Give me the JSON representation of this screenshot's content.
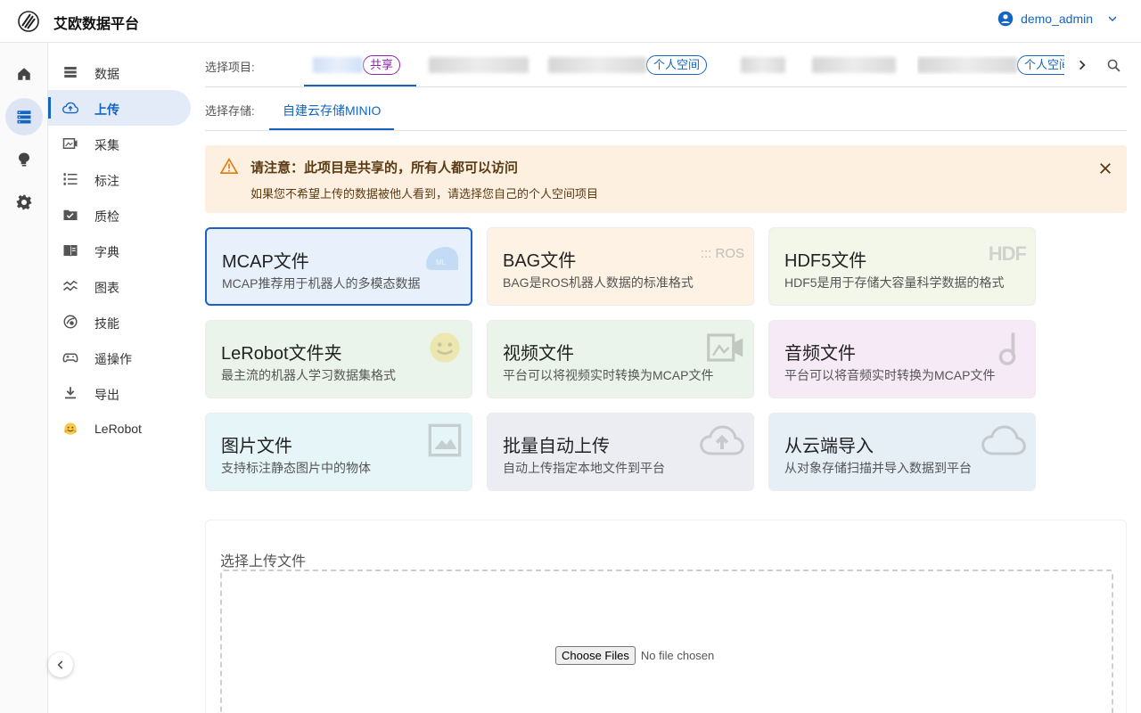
{
  "header": {
    "app_title": "艾欧数据平台",
    "username": "demo_admin"
  },
  "rail": {
    "items": [
      {
        "icon": "home-icon"
      },
      {
        "icon": "storage-icon",
        "active": true
      },
      {
        "icon": "lightbulb-brain-icon"
      },
      {
        "icon": "gear-icon"
      }
    ]
  },
  "sidebar": {
    "items": [
      {
        "label": "数据",
        "icon": "dataset-icon"
      },
      {
        "label": "上传",
        "icon": "cloud-upload-icon",
        "active": true
      },
      {
        "label": "采集",
        "icon": "capture-icon"
      },
      {
        "label": "标注",
        "icon": "list-icon"
      },
      {
        "label": "质检",
        "icon": "folder-check-icon"
      },
      {
        "label": "字典",
        "icon": "book-icon"
      },
      {
        "label": "图表",
        "icon": "chart-icon"
      },
      {
        "label": "技能",
        "icon": "skill-icon"
      },
      {
        "label": "遥操作",
        "icon": "gamepad-icon"
      },
      {
        "label": "导出",
        "icon": "download-icon"
      },
      {
        "label": "LeRobot",
        "icon": "lerobot-emoji-icon"
      }
    ]
  },
  "project_selector": {
    "label": "选择项目:",
    "tabs": [
      {
        "chip": "共享",
        "chip_type": "shared",
        "selected": true
      },
      {
        "chip": ""
      },
      {
        "chip": "个人空间",
        "chip_type": "personal"
      },
      {
        "chip": ""
      },
      {
        "chip": ""
      },
      {
        "chip": "个人空间",
        "chip_type": "personal"
      }
    ]
  },
  "storage_selector": {
    "label": "选择存储:",
    "tab": "自建云存储MINIO"
  },
  "alert": {
    "title": "请注意：此项目是共享的，所有人都可以访问",
    "body": "如果您不希望上传的数据被他人看到，请选择您自己的个人空间项目"
  },
  "cards": [
    {
      "title": "MCAP文件",
      "desc": "MCAP推荐用于机器人的多模态数据",
      "color": "#e8f1fb",
      "selected": true
    },
    {
      "title": "BAG文件",
      "desc": "BAG是ROS机器人数据的标准格式",
      "color": "#fdf2e4",
      "deco_text": "::: ROS"
    },
    {
      "title": "HDF5文件",
      "desc": "HDF5是用于存储大容量科学数据的格式",
      "color": "#f2f7ea",
      "deco_text": "HDF"
    },
    {
      "title": "LeRobot文件夹",
      "desc": "最主流的机器人学习数据集格式",
      "color": "#eaf4ea"
    },
    {
      "title": "视频文件",
      "desc": "平台可以将视频实时转换为MCAP文件",
      "color": "#eaf4ea"
    },
    {
      "title": "音频文件",
      "desc": "平台可以将音频实时转换为MCAP文件",
      "color": "#f5eaf5"
    },
    {
      "title": "图片文件",
      "desc": "支持标注静态图片中的物体",
      "color": "#e6f6f8"
    },
    {
      "title": "批量自动上传",
      "desc": "自动上传指定本地文件到平台",
      "color": "#ececf3"
    },
    {
      "title": "从云端导入",
      "desc": "从对象存储扫描并导入数据到平台",
      "color": "#e6eef6"
    }
  ],
  "upload": {
    "label": "选择上传文件",
    "button": "Choose Files",
    "status": "No file chosen"
  }
}
